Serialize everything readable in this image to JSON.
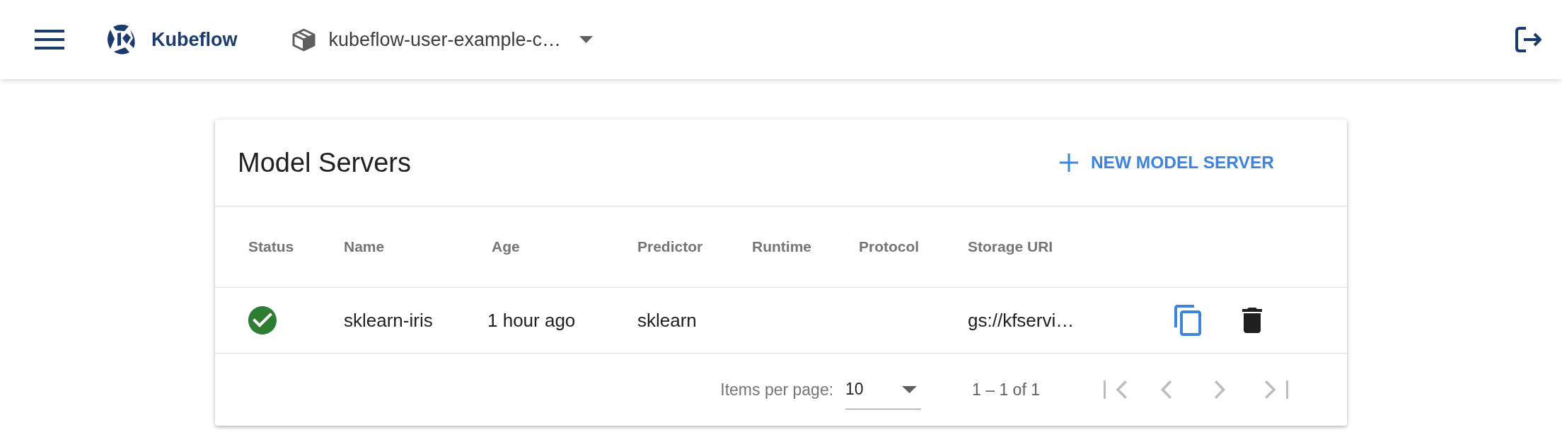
{
  "top_bar": {
    "brand": "Kubeflow",
    "namespace": "kubeflow-user-example-c…"
  },
  "card": {
    "title": "Model Servers",
    "new_button": "NEW MODEL SERVER"
  },
  "table": {
    "columns": [
      "Status",
      "Name",
      "Age",
      "Predictor",
      "Runtime",
      "Protocol",
      "Storage URI"
    ],
    "rows": [
      {
        "ready": true,
        "name": "sklearn-iris",
        "age": "1 hour ago",
        "predictor": "sklearn",
        "storage_uri": "gs://kfservi…"
      }
    ]
  },
  "paginator": {
    "label": "Items per page:",
    "page_size": "10",
    "range": "1 – 1 of 1",
    "buttons": [
      {
        "kind": "first",
        "disabled": true
      },
      {
        "kind": "previous",
        "disabled": true
      },
      {
        "kind": "next",
        "disabled": true
      },
      {
        "kind": "last",
        "disabled": true
      }
    ]
  }
}
